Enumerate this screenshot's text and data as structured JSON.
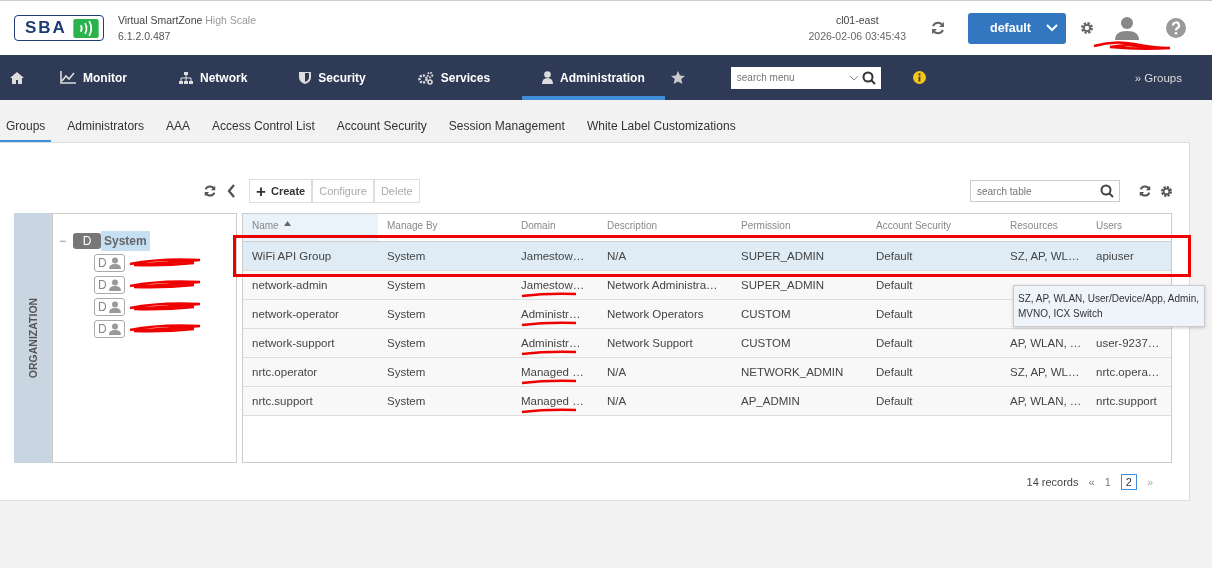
{
  "header": {
    "logo_text": "SBA",
    "product": "Virtual SmartZone",
    "edition": "High Scale",
    "version": "6.1.2.0.487",
    "cluster": "cl01-east",
    "datetime": "2026-02-06  03:45:43",
    "domain_button": "default",
    "user_redacted": true
  },
  "nav": [
    {
      "kind": "home",
      "selected": false
    },
    {
      "kind": "monitor",
      "label": "Monitor",
      "selected": false
    },
    {
      "kind": "network",
      "label": "Network",
      "selected": false
    },
    {
      "kind": "security",
      "label": "Security",
      "selected": false
    },
    {
      "kind": "services",
      "label": "Services",
      "selected": false
    },
    {
      "kind": "admin",
      "label": "Administration",
      "selected": true
    },
    {
      "kind": "star",
      "selected": false
    }
  ],
  "search_menu": {
    "placeholder": "search menu"
  },
  "breadcrumb": {
    "icon": "»",
    "label": "Groups"
  },
  "subtabs": [
    {
      "label": "Groups",
      "selected": true
    },
    {
      "label": "Administrators",
      "selected": false
    },
    {
      "label": "AAA",
      "selected": false
    },
    {
      "label": "Access Control List",
      "selected": false
    },
    {
      "label": "Account Security",
      "selected": false
    },
    {
      "label": "Session Management",
      "selected": false
    },
    {
      "label": "White Label Customizations",
      "selected": false
    }
  ],
  "tree": {
    "side_label": "ORGANIZATION",
    "root": {
      "toggle": "−",
      "badge": "D",
      "label": "System",
      "selected": true,
      "children": [
        {
          "badge": "D",
          "redacted": true
        },
        {
          "badge": "D",
          "redacted": true
        },
        {
          "badge": "D",
          "redacted": true
        },
        {
          "badge": "D",
          "redacted": true
        }
      ]
    }
  },
  "toolbar": {
    "buttons": [
      {
        "label": "Create",
        "icon": "+",
        "disabled": false
      },
      {
        "label": "Configure",
        "disabled": true
      },
      {
        "label": "Delete",
        "disabled": true
      }
    ],
    "search": {
      "placeholder": "search table"
    }
  },
  "table": {
    "columns": [
      {
        "label": "Name",
        "sorted": true
      },
      {
        "label": "Manage By",
        "sorted": false
      },
      {
        "label": "Domain",
        "sorted": false
      },
      {
        "label": "Description",
        "sorted": false
      },
      {
        "label": "Permission",
        "sorted": false
      },
      {
        "label": "Account Security",
        "sorted": false
      },
      {
        "label": "Resources",
        "sorted": false
      },
      {
        "label": "Users",
        "sorted": false
      }
    ],
    "rows": [
      {
        "selected": true,
        "domain_redacted": false,
        "cells": [
          "WiFi API Group",
          "System",
          "Jamestow…",
          "N/A",
          "SUPER_ADMIN",
          "Default",
          "SZ, AP, WL…",
          "apiuser"
        ]
      },
      {
        "selected": false,
        "domain_redacted": true,
        "cells": [
          "network-admin",
          "System",
          "Jamestow…",
          "Network Administra…",
          "SUPER_ADMIN",
          "Default"
        ]
      },
      {
        "selected": false,
        "domain_redacted": true,
        "cells": [
          "network-operator",
          "System",
          "Administr…",
          "Network Operators",
          "CUSTOM",
          "Default"
        ]
      },
      {
        "selected": false,
        "domain_redacted": true,
        "cells": [
          "network-support",
          "System",
          "Administr…",
          "Network Support",
          "CUSTOM",
          "Default",
          "AP, WLAN, …",
          "user-9237…"
        ]
      },
      {
        "selected": false,
        "domain_redacted": true,
        "cells": [
          "nrtc.operator",
          "System",
          "Managed …",
          "N/A",
          "NETWORK_ADMIN",
          "Default",
          "SZ, AP, WL…",
          "nrtc.opera…"
        ]
      },
      {
        "selected": false,
        "domain_redacted": true,
        "cells": [
          "nrtc.support",
          "System",
          "Managed …",
          "N/A",
          "AP_ADMIN",
          "Default",
          "AP, WLAN, …",
          "nrtc.support"
        ]
      }
    ]
  },
  "tooltip": {
    "text": "SZ, AP, WLAN, User/Device/App, Admin, MVNO, ICX Switch"
  },
  "pager": {
    "records": "14 records",
    "prev": "«",
    "next": "»",
    "pages": [
      {
        "label": "1",
        "selected": false
      },
      {
        "label": "2",
        "selected": true
      }
    ]
  },
  "annotation": {
    "highlight_row": true
  }
}
